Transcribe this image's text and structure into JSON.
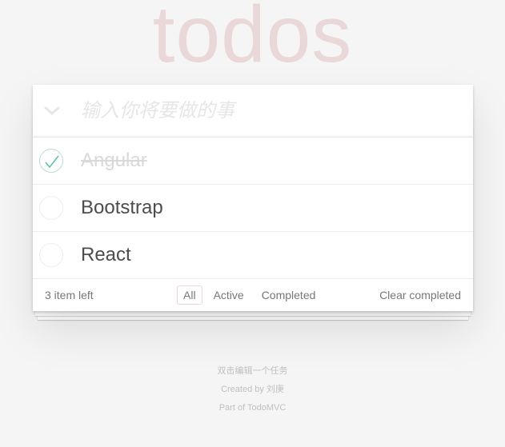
{
  "app": {
    "title": "todos"
  },
  "header": {
    "placeholder": "输入你将要做的事",
    "input_value": ""
  },
  "todos": [
    {
      "label": "Angular",
      "completed": true
    },
    {
      "label": "Bootstrap",
      "completed": false
    },
    {
      "label": "React",
      "completed": false
    }
  ],
  "footer": {
    "count": "3 item left",
    "filters": [
      {
        "label": "All",
        "selected": true
      },
      {
        "label": "Active",
        "selected": false
      },
      {
        "label": "Completed",
        "selected": false
      }
    ],
    "clear_label": "Clear completed"
  },
  "info": {
    "line1": "双击编辑一个任务",
    "line2": "Created by 刘庚",
    "line3": "Part of TodoMVC"
  },
  "icons": {
    "toggle_all": "chevron-down-icon",
    "check": "check-icon"
  },
  "colors": {
    "title": "#eaD7D7",
    "check": "#5dc2af",
    "selected_border": "#e6c8c8"
  }
}
